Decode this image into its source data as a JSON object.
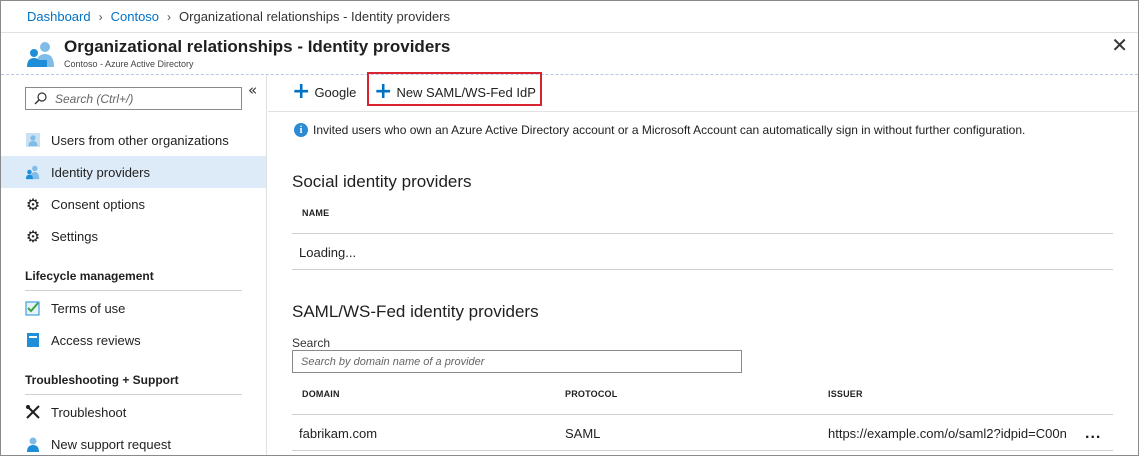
{
  "breadcrumb": {
    "items": [
      "Dashboard",
      "Contoso"
    ],
    "current": "Organizational relationships - Identity providers"
  },
  "header": {
    "title": "Organizational relationships - Identity providers",
    "subtitle": "Contoso - Azure Active Directory"
  },
  "leftnav": {
    "search_placeholder": "Search (Ctrl+/)",
    "items": [
      {
        "label": "Users from other organizations",
        "icon": "users-icon"
      },
      {
        "label": "Identity providers",
        "icon": "identity-providers-icon",
        "active": true
      },
      {
        "label": "Consent options",
        "icon": "gear-icon"
      },
      {
        "label": "Settings",
        "icon": "gear-icon"
      }
    ],
    "section_lifecycle": "Lifecycle management",
    "lifecycle_items": [
      {
        "label": "Terms of use",
        "icon": "terms-checklist-icon"
      },
      {
        "label": "Access reviews",
        "icon": "access-reviews-icon"
      }
    ],
    "section_troubleshooting": "Troubleshooting + Support",
    "troubleshooting_items": [
      {
        "label": "Troubleshoot",
        "icon": "wrench-icon"
      },
      {
        "label": "New support request",
        "icon": "support-person-icon"
      }
    ]
  },
  "toolbar": {
    "google_label": "Google",
    "new_idp_label": "New SAML/WS-Fed IdP"
  },
  "content": {
    "info_text": "Invited users who own an Azure Active Directory account or a Microsoft Account can automatically sign in without further configuration.",
    "social_title": "Social identity providers",
    "social_col_name": "NAME",
    "social_loading": "Loading...",
    "saml_title": "SAML/WS-Fed identity providers",
    "search_label": "Search",
    "search_placeholder": "Search by domain name of a provider",
    "saml_columns": [
      "DOMAIN",
      "PROTOCOL",
      "ISSUER"
    ],
    "saml_rows": [
      {
        "domain": "fabrikam.com",
        "protocol": "SAML",
        "issuer": "https://example.com/o/saml2?idpid=C00n"
      }
    ],
    "row_menu": "..."
  },
  "colors": {
    "link": "#0072c6",
    "active_nav": "#ddeaf7",
    "highlight_border": "#d9232e",
    "plus": "#0072c6"
  }
}
